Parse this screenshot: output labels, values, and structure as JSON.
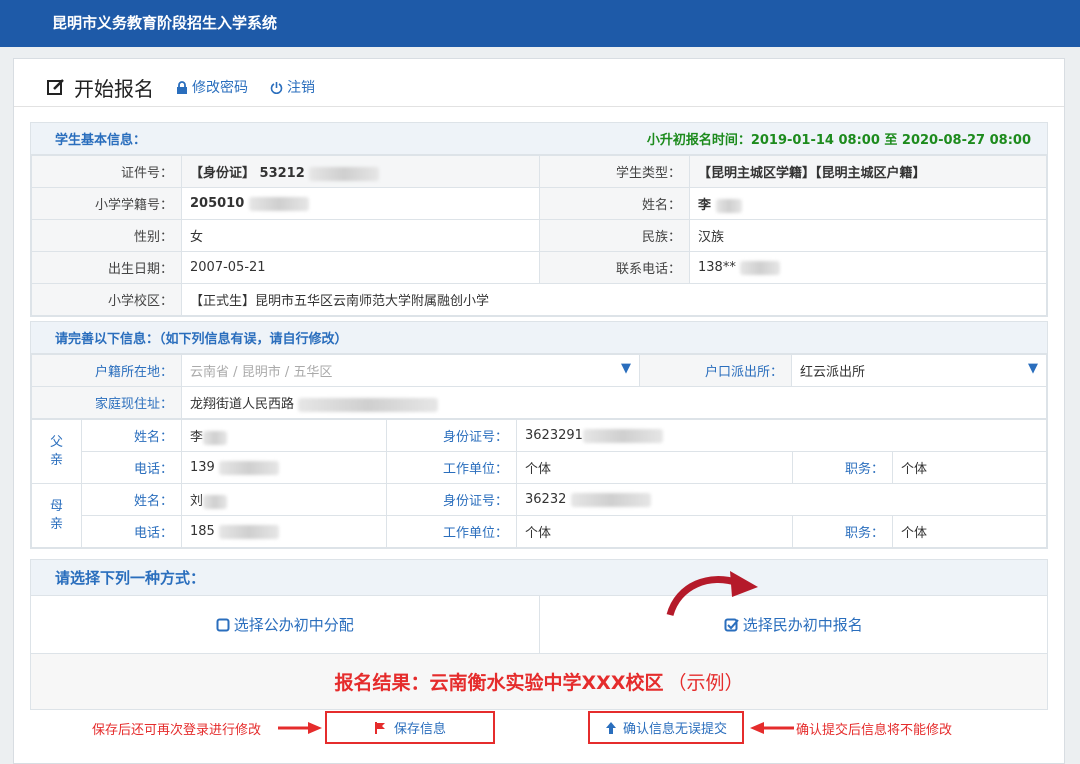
{
  "app": {
    "title": "昆明市义务教育阶段招生入学系统"
  },
  "header": {
    "title": "开始报名",
    "change_password": "修改密码",
    "logout": "注销"
  },
  "basic": {
    "title": "学生基本信息：",
    "enroll_time": "小升初报名时间：2019-01-14 08:00 至 2020-08-27 08:00",
    "id_label": "证件号：",
    "id_value": "【身份证】 53212",
    "type_label": "学生类型：",
    "type_value": "【昆明主城区学籍】【昆明主城区户籍】",
    "school_no_label": "小学学籍号：",
    "school_no_value": "205010",
    "name_label": "姓名：",
    "name_value": "李",
    "gender_label": "性别：",
    "gender_value": "女",
    "ethnic_label": "民族：",
    "ethnic_value": "汉族",
    "birth_label": "出生日期：",
    "birth_value": "2007-05-21",
    "phone_label": "联系电话：",
    "phone_value": "138**",
    "campus_label": "小学校区：",
    "campus_value": "【正式生】昆明市五华区云南师范大学附属融创小学"
  },
  "complete": {
    "title": "请完善以下信息：（如下列信息有误，请自行修改）",
    "huji_label": "户籍所在地：",
    "huji": {
      "province": "云南省",
      "city": "昆明市",
      "district": "五华区",
      "sep": "/"
    },
    "police_label": "户口派出所：",
    "police_value": "红云派出所",
    "home_label": "家庭现住址：",
    "home_value": "龙翔街道人民西路",
    "father": {
      "side": [
        "父",
        "亲"
      ],
      "name_label": "姓名：",
      "name_value": "李",
      "id_label": "身份证号：",
      "id_value": "3623291",
      "phone_label": "电话：",
      "phone_value": "139",
      "work_label": "工作单位：",
      "work_value": "个体",
      "job_label": "职务：",
      "job_value": "个体"
    },
    "mother": {
      "side": [
        "母",
        "亲"
      ],
      "name_label": "姓名：",
      "name_value": "刘",
      "id_label": "身份证号：",
      "id_value": "36232",
      "phone_label": "电话：",
      "phone_value": "185",
      "work_label": "工作单位：",
      "work_value": "个体",
      "job_label": "职务：",
      "job_value": "个体"
    }
  },
  "choose": {
    "title": "请选择下列一种方式：",
    "public_option": "选择公办初中分配",
    "private_option": "选择民办初中报名",
    "result_main": "报名结果：云南衡水实验中学XXX校区",
    "result_note": "（示例）"
  },
  "actions": {
    "save": "保存信息",
    "submit": "确认信息无误提交",
    "save_note": "保存后还可再次登录进行修改",
    "submit_note": "确认提交后信息将不能修改"
  },
  "colors": {
    "accent": "#2a6ebd",
    "topbar": "#1e5aa8",
    "highlight": "#e52c2c",
    "time": "#1d8b1d"
  }
}
